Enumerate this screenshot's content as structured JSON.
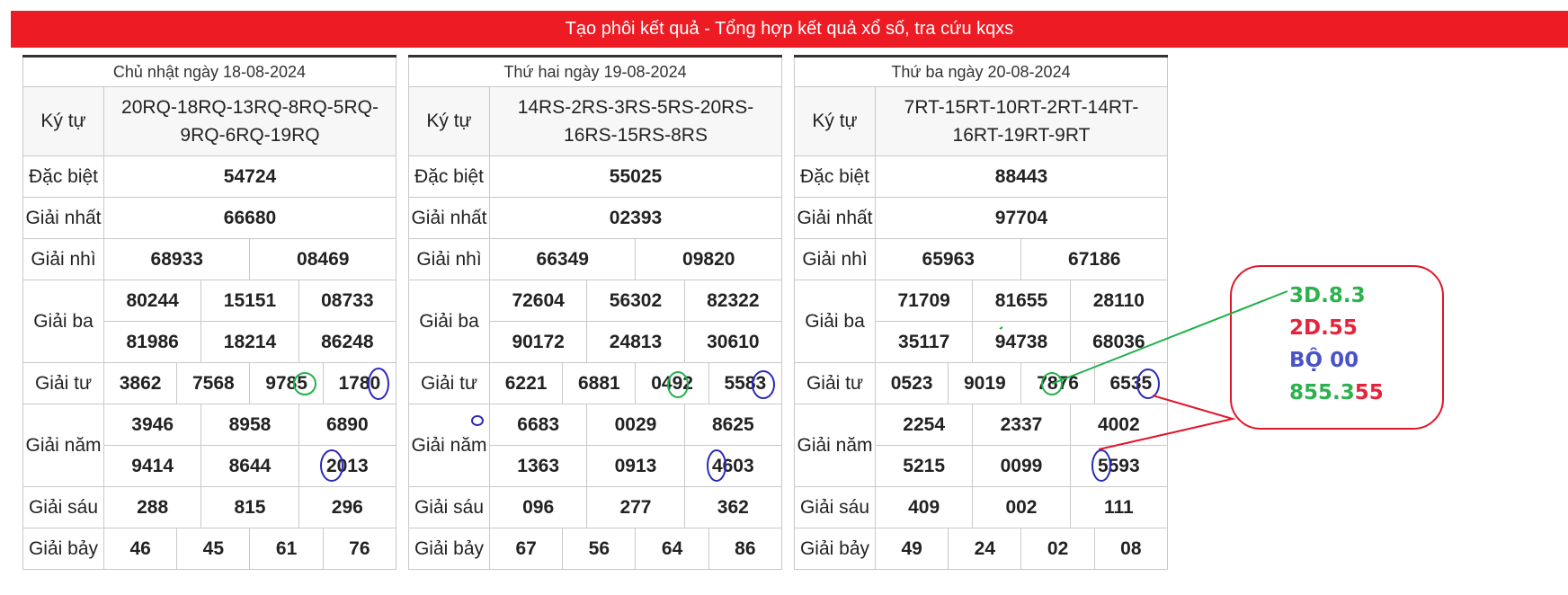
{
  "header": {
    "title": "Tạo phôi kết quả - Tổng hợp kết quả xổ số, tra cứu kqxs"
  },
  "labels": {
    "kytu": "Ký tự",
    "dacbiet": "Đặc biệt",
    "nhat": "Giải nhất",
    "nhi": "Giải nhì",
    "ba": "Giải ba",
    "tu": "Giải tư",
    "nam": "Giải năm",
    "sau": "Giải sáu",
    "bay": "Giải bảy"
  },
  "days": [
    {
      "date": "Chủ nhật ngày 18-08-2024",
      "kytu_line1": "20RQ-18RQ-13RQ-8RQ-5RQ-",
      "kytu_line2": "9RQ-6RQ-19RQ",
      "dacbiet": "54724",
      "nhat": "66680",
      "nhi": [
        "68933",
        "08469"
      ],
      "ba": [
        "80244",
        "15151",
        "08733",
        "81986",
        "18214",
        "86248"
      ],
      "tu": [
        "3862",
        "7568",
        "9785",
        "1780"
      ],
      "nam": [
        "3946",
        "8958",
        "6890",
        "9414",
        "8644",
        "2013"
      ],
      "sau": [
        "288",
        "815",
        "296"
      ],
      "bay": [
        "46",
        "45",
        "61",
        "76"
      ]
    },
    {
      "date": "Thứ hai ngày 19-08-2024",
      "kytu_line1": "14RS-2RS-3RS-5RS-20RS-",
      "kytu_line2": "16RS-15RS-8RS",
      "dacbiet": "55025",
      "nhat": "02393",
      "nhi": [
        "66349",
        "09820"
      ],
      "ba": [
        "72604",
        "56302",
        "82322",
        "90172",
        "24813",
        "30610"
      ],
      "tu": [
        "6221",
        "6881",
        "0492",
        "5583"
      ],
      "nam": [
        "6683",
        "0029",
        "8625",
        "1363",
        "0913",
        "4603"
      ],
      "sau": [
        "096",
        "277",
        "362"
      ],
      "bay": [
        "67",
        "56",
        "64",
        "86"
      ]
    },
    {
      "date": "Thứ ba ngày 20-08-2024",
      "kytu_line1": "7RT-15RT-10RT-2RT-14RT-",
      "kytu_line2": "16RT-19RT-9RT",
      "dacbiet": "88443",
      "nhat": "97704",
      "nhi": [
        "65963",
        "67186"
      ],
      "ba": [
        "71709",
        "81655",
        "28110",
        "35117",
        "94738",
        "68036"
      ],
      "tu": [
        "0523",
        "9019",
        "7876",
        "6535"
      ],
      "nam": [
        "2254",
        "2337",
        "4002",
        "5215",
        "0099",
        "5593"
      ],
      "sau": [
        "409",
        "002",
        "111"
      ],
      "bay": [
        "49",
        "24",
        "02",
        "08"
      ]
    }
  ],
  "note": {
    "line1": "3D.8.3",
    "line2": "2D.55",
    "line3": "BỘ 00",
    "line4a": "855.3",
    "line4b": "55",
    "colors": {
      "green": "#2bb24c",
      "red": "#e5243b",
      "blue": "#4a52c9"
    }
  },
  "colors": {
    "header_bg": "#ed1c24",
    "special": "#e60000",
    "annotation_green": "#22b14c",
    "annotation_blue": "#2b2bb8",
    "annotation_red": "#e0162b"
  }
}
